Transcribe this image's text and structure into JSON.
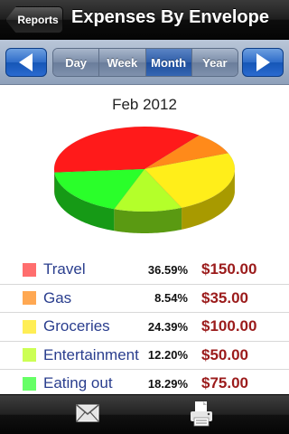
{
  "navbar": {
    "back_label": "Reports",
    "title": "Expenses By Envelope"
  },
  "period_selector": {
    "prev_icon": "left-arrow-icon",
    "next_icon": "right-arrow-icon",
    "segments": [
      {
        "label": "Day",
        "selected": false
      },
      {
        "label": "Week",
        "selected": false
      },
      {
        "label": "Month",
        "selected": true
      },
      {
        "label": "Year",
        "selected": false
      }
    ]
  },
  "chart_title": "Feb 2012",
  "chart_data": {
    "type": "pie",
    "title": "Feb 2012",
    "categories": [
      "Travel",
      "Gas",
      "Groceries",
      "Entertainment",
      "Eating out"
    ],
    "values": [
      36.59,
      8.54,
      24.39,
      12.2,
      18.29
    ],
    "colors": [
      "#ff1a1a",
      "#ff8a1a",
      "#ffee1a",
      "#b4ff2a",
      "#2aff2a"
    ],
    "side_colors": [
      "#9b0000",
      "#a84e00",
      "#a89a00",
      "#5a9a12",
      "#169a16"
    ]
  },
  "legend": [
    {
      "name": "Travel",
      "percent": "36.59%",
      "amount": "$150.00",
      "color": "#ff6e6e"
    },
    {
      "name": "Gas",
      "percent": "8.54%",
      "amount": "$35.00",
      "color": "#ffa852"
    },
    {
      "name": "Groceries",
      "percent": "24.39%",
      "amount": "$100.00",
      "color": "#ffee55"
    },
    {
      "name": "Entertainment",
      "percent": "12.20%",
      "amount": "$50.00",
      "color": "#ccff55"
    },
    {
      "name": "Eating out",
      "percent": "18.29%",
      "amount": "$75.00",
      "color": "#66ff66"
    }
  ],
  "toolbar": {
    "mail_icon": "mail-icon",
    "print_icon": "print-icon"
  }
}
